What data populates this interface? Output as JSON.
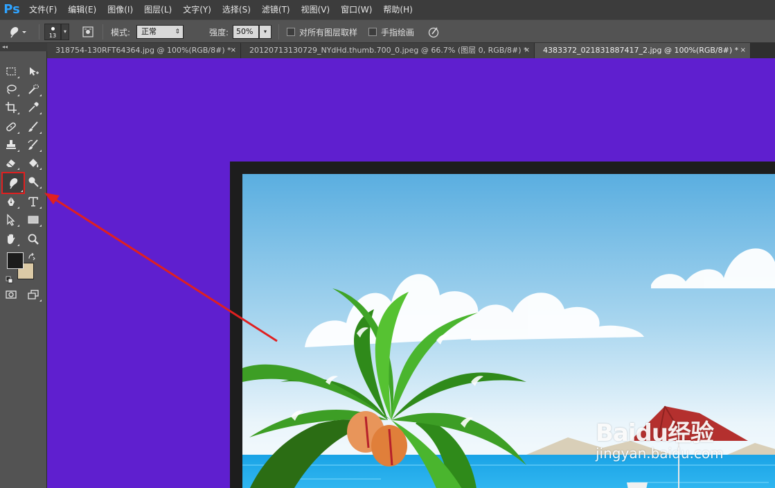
{
  "app": {
    "logo": "Ps",
    "menu": [
      "文件(F)",
      "编辑(E)",
      "图像(I)",
      "图层(L)",
      "文字(Y)",
      "选择(S)",
      "滤镜(T)",
      "视图(V)",
      "窗口(W)",
      "帮助(H)"
    ]
  },
  "options": {
    "brush_size": "13",
    "mode_label": "模式:",
    "mode_value": "正常",
    "strength_label": "强度:",
    "strength_value": "50%",
    "sample_all_layers": "对所有图层取样",
    "finger_painting": "手指绘画"
  },
  "tabs": [
    {
      "label": "318754-130RFT64364.jpg @ 100%(RGB/8#) *",
      "close": "×",
      "active": false
    },
    {
      "label": "20120713130729_NYdHd.thumb.700_0.jpeg @ 66.7% (图层 0, RGB/8#) *",
      "close": "×",
      "active": false
    },
    {
      "label": "4383372_021831887417_2.jpg @ 100%(RGB/8#) *",
      "close": "×",
      "active": true
    }
  ],
  "toolbox": {
    "collapse": "◂◂",
    "tools": [
      "rectangular-marquee",
      "move",
      "lasso",
      "quick-selection",
      "crop",
      "eyedropper",
      "healing-brush",
      "brush",
      "clone-stamp",
      "history-brush",
      "eraser",
      "paint-bucket",
      "smudge",
      "dodge",
      "pen",
      "type",
      "path-selection",
      "rectangle",
      "hand",
      "zoom"
    ],
    "selected_tool": "smudge",
    "foreground_color": "#1c1c1c",
    "background_color": "#dccaa6"
  },
  "canvas": {
    "background_color": "#5f1fcf"
  },
  "watermark": {
    "line1": "Baidu经验",
    "line2": "jingyan.baidu.com"
  },
  "annotation": {
    "highlight_color": "#e02020"
  }
}
